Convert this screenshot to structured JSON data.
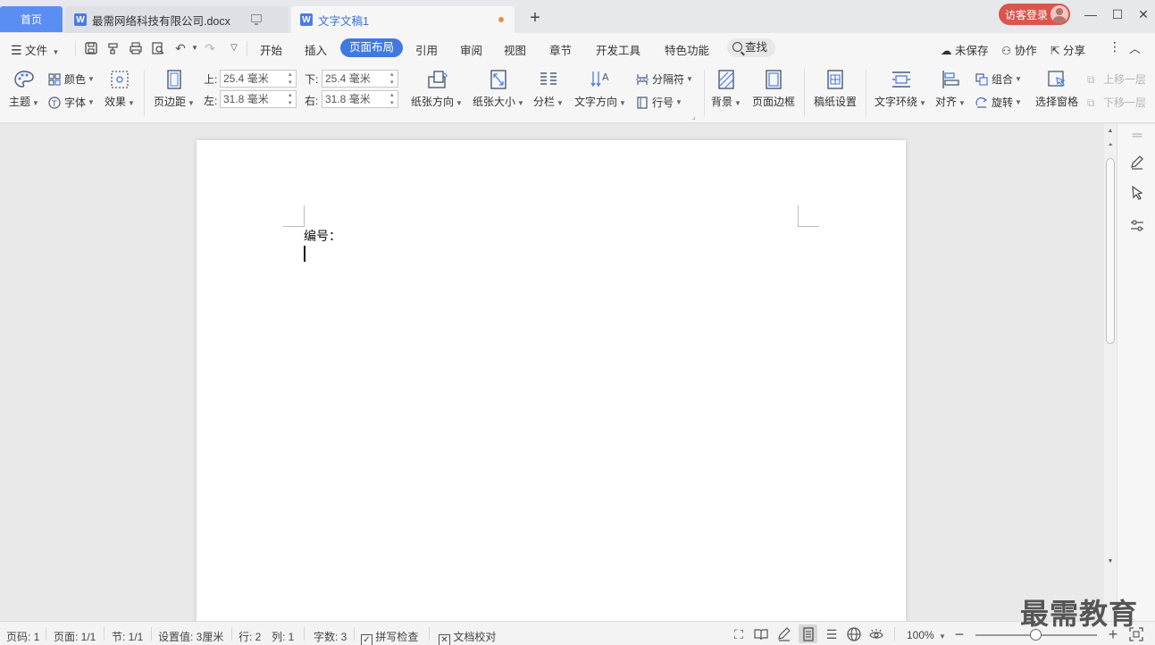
{
  "tabs": {
    "home": "首页",
    "items": [
      {
        "label": "最需网络科技有限公司.docx"
      },
      {
        "label": "文字文稿1"
      }
    ],
    "add": "+"
  },
  "titlebar": {
    "login": "访客登录",
    "minimize": "—",
    "maximize": "☐",
    "close": "✕"
  },
  "menu": {
    "file": "文件",
    "items": [
      "开始",
      "插入",
      "页面布局",
      "引用",
      "审阅",
      "视图",
      "章节",
      "开发工具",
      "特色功能"
    ],
    "active": "页面布局",
    "search": "查找",
    "unsaved": "未保存",
    "collab": "协作",
    "share": "分享"
  },
  "ribbon": {
    "theme": "主题",
    "color": "颜色",
    "font": "字体",
    "effect": "效果",
    "margins": "页边距",
    "top_label": "上:",
    "top_value": "25.4 毫米",
    "bottom_label": "下:",
    "bottom_value": "25.4 毫米",
    "left_label": "左:",
    "left_value": "31.8 毫米",
    "right_label": "右:",
    "right_value": "31.8 毫米",
    "orientation": "纸张方向",
    "size": "纸张大小",
    "columns": "分栏",
    "text_direction": "文字方向",
    "breaks": "分隔符",
    "line_numbers": "行号",
    "background": "背景",
    "page_border": "页面边框",
    "grid_paper": "稿纸设置",
    "wrap_text": "文字环绕",
    "align": "对齐",
    "group": "组合",
    "rotate": "旋转",
    "selection_pane": "选择窗格",
    "bring_forward": "上移一层",
    "send_backward": "下移一层"
  },
  "document": {
    "line1": "编号："
  },
  "statusbar": {
    "page_num": "页码: 1",
    "pages": "页面: 1/1",
    "section": "节: 1/1",
    "setting": "设置值: 3厘米",
    "row": "行: 2",
    "col": "列: 1",
    "word_count": "字数: 3",
    "spell_check": "拼写检查",
    "doc_proof": "文档校对",
    "zoom": "100%",
    "zoom_level": 0.5
  },
  "watermark": "最需教育",
  "colors": {
    "accent": "#3f7ae0",
    "home_tab": "#5b8ef2",
    "login": "#d9564e",
    "unsaved_dot": "#f28c3b"
  }
}
